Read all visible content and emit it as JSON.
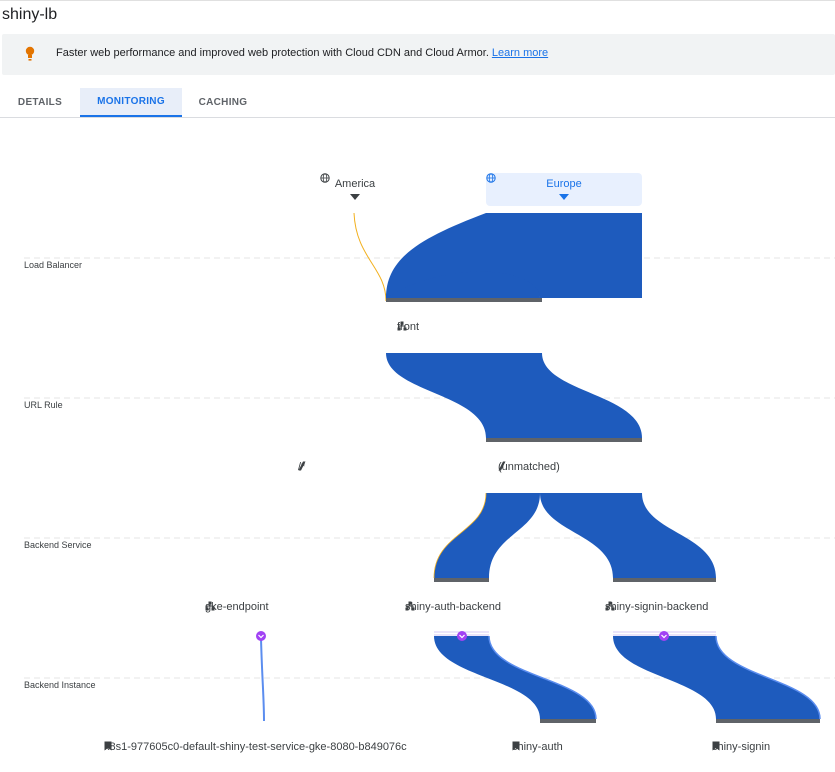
{
  "page": {
    "title": "shiny-lb"
  },
  "banner": {
    "message": "Faster web performance and improved web protection with Cloud CDN and Cloud Armor.",
    "link": "Learn more"
  },
  "tabs": [
    {
      "label": "DETAILS",
      "active": false
    },
    {
      "label": "MONITORING",
      "active": true
    },
    {
      "label": "CACHING",
      "active": false
    }
  ],
  "colors": {
    "flow": "#1e5bbd",
    "accent": "#1a73e8",
    "america_flow": "#f2b01e",
    "instance_marker": "#a142f4"
  },
  "monitoring": {
    "regions": [
      {
        "name": "America",
        "selected": false,
        "icon": "globe-icon"
      },
      {
        "name": "Europe",
        "selected": true,
        "icon": "globe-icon"
      }
    ],
    "row_labels": [
      "Load Balancer",
      "URL Rule",
      "Backend Service",
      "Backend Instance"
    ],
    "load_balancer": {
      "name": "front",
      "icon": "network-icon"
    },
    "url_rules": [
      {
        "name": "/*",
        "icon": "slash-icon"
      },
      {
        "name": "(unmatched)",
        "icon": "slash-icon"
      }
    ],
    "backend_services": [
      {
        "name": "gke-endpoint",
        "icon": "network-icon"
      },
      {
        "name": "shiny-auth-backend",
        "icon": "network-icon"
      },
      {
        "name": "shiny-signin-backend",
        "icon": "network-icon"
      }
    ],
    "backend_instances": [
      {
        "name": "k8s1-977605c0-default-shiny-test-service-gke-8080-b849076c",
        "icon": "bookmark-icon"
      },
      {
        "name": "shiny-auth",
        "icon": "bookmark-icon"
      },
      {
        "name": "shiny-signin",
        "icon": "bookmark-icon"
      }
    ]
  }
}
